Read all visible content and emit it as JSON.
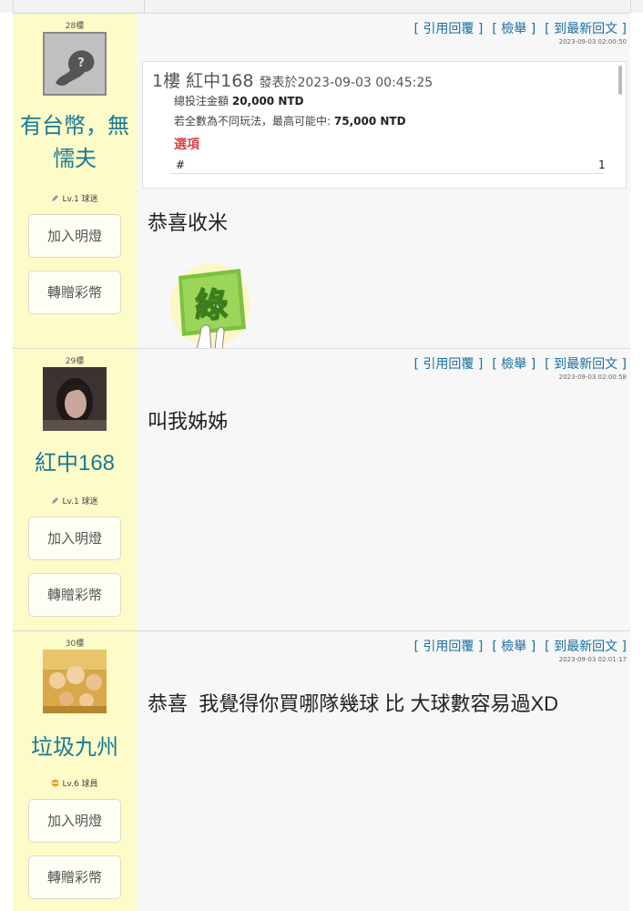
{
  "actions": {
    "quote": "[ 引用回覆 ]",
    "report": "[ 檢舉 ]",
    "latest": "[ 到最新回文 ]"
  },
  "user_buttons": {
    "follow": "加入明燈",
    "gift": "轉贈彩幣"
  },
  "posts": [
    {
      "floor": "28樓",
      "username_line1": "有台幣，無",
      "username_line2": "懦夫",
      "level": "Lv.1 球迷",
      "timestamp": "2023-09-03 02:00:50",
      "message": "恭喜收米",
      "quote": {
        "floor": "1樓",
        "author": "紅中168",
        "posted_prefix": "發表於",
        "posted_at": "2023-09-03 00:45:25",
        "total_label": "總投注金額",
        "total_value": "20,000 NTD",
        "max_label": "若全數為不同玩法，最高可能中:",
        "max_value": "75,000 NTD",
        "options_label": "選項",
        "col_hash": "#",
        "col_one": "1"
      },
      "sticker_text": "綠"
    },
    {
      "floor": "29樓",
      "username_line1": "紅中168",
      "level": "Lv.1 球迷",
      "timestamp": "2023-09-03 02:00:58",
      "message": "叫我姊姊"
    },
    {
      "floor": "30樓",
      "username_line1": "垃圾九州",
      "level": "Lv.6 球員",
      "timestamp": "2023-09-03 02:01:17",
      "message": "恭喜  我覺得你買哪隊幾球 比 大球數容易過XD"
    }
  ],
  "colors": {
    "sidebar": "#fdfbc8",
    "username": "#1a7a96",
    "links": "#1a6fa0",
    "options": "#d94848"
  },
  "icons": [
    "pencil-icon",
    "ball-icon",
    "default-avatar-icon"
  ]
}
